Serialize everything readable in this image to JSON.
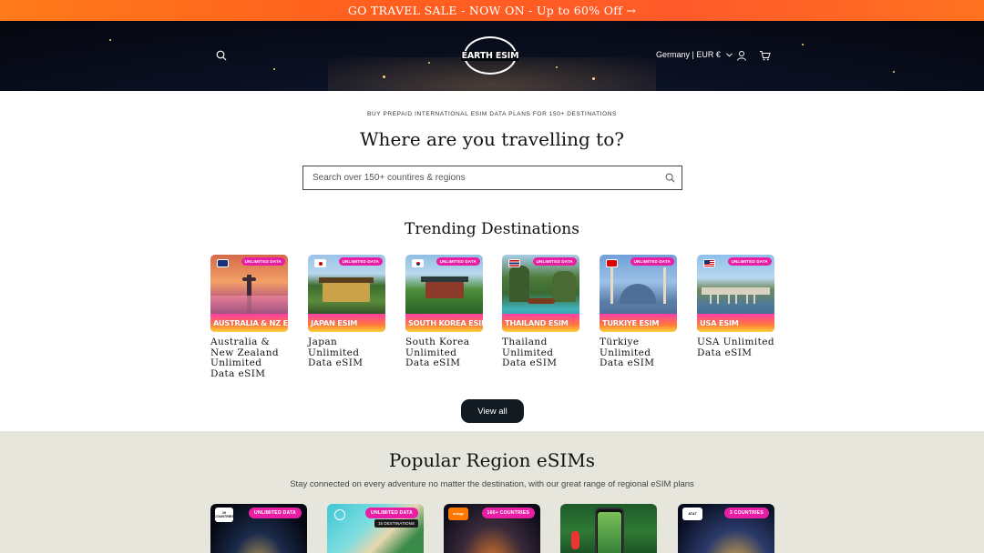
{
  "announcement": {
    "text": "GO TRAVEL SALE - NOW ON - Up to 60% Off →"
  },
  "header": {
    "logo_text": "EARTH ESIM",
    "locale": "Germany | EUR €",
    "icons": [
      "search-icon",
      "chevron-down-icon",
      "account-icon",
      "cart-icon"
    ]
  },
  "hero": {
    "subtitle": "BUY PREPAID INTERNATIONAL ESIM DATA PLANS FOR 150+ DESTINATIONS",
    "title": "Where are you travelling to?",
    "search_placeholder": "Search over 150+ countires & regions"
  },
  "trending": {
    "title": "Trending Destinations",
    "badge": "UNLIMITED DATA",
    "items": [
      {
        "band": "AUSTRALIA & NZ ESIM",
        "name": "Australia & New Zealand Unlimited Data eSIM"
      },
      {
        "band": "JAPAN ESIM",
        "name": "Japan Unlimited Data eSIM"
      },
      {
        "band": "SOUTH KOREA ESIM",
        "name": "South Korea Unlimited Data eSIM"
      },
      {
        "band": "THAILAND ESIM",
        "name": "Thailand Unlimited Data eSIM"
      },
      {
        "band": "TURKIYE ESIM",
        "name": "Türkiye Unlimited Data eSIM"
      },
      {
        "band": "USA ESIM",
        "name": "USA Unlimited Data eSIM"
      }
    ],
    "view_all_label": "View all"
  },
  "regions": {
    "title": "Popular Region eSIMs",
    "subtitle": "Stay connected on every adventure no matter the destination, with our great range of regional eSIM plans",
    "cards": [
      {
        "badge": "UNLIMITED DATA",
        "small_num": "29",
        "small_label": "COUNTRIES"
      },
      {
        "badge": "UNLIMITED DATA",
        "dark_label": "15 DESTINATIONS"
      },
      {
        "badge": "160+ COUNTRIES",
        "small_label": "orange"
      },
      {
        "badge": ""
      },
      {
        "badge": "3 COUNTRIES",
        "small_label": "AT&T"
      }
    ]
  },
  "colors": {
    "accent_pink": "#e91ea5",
    "announce_orange": "#ff5e1f",
    "button_dark": "#121a22",
    "region_bg": "#e7e6dc"
  }
}
